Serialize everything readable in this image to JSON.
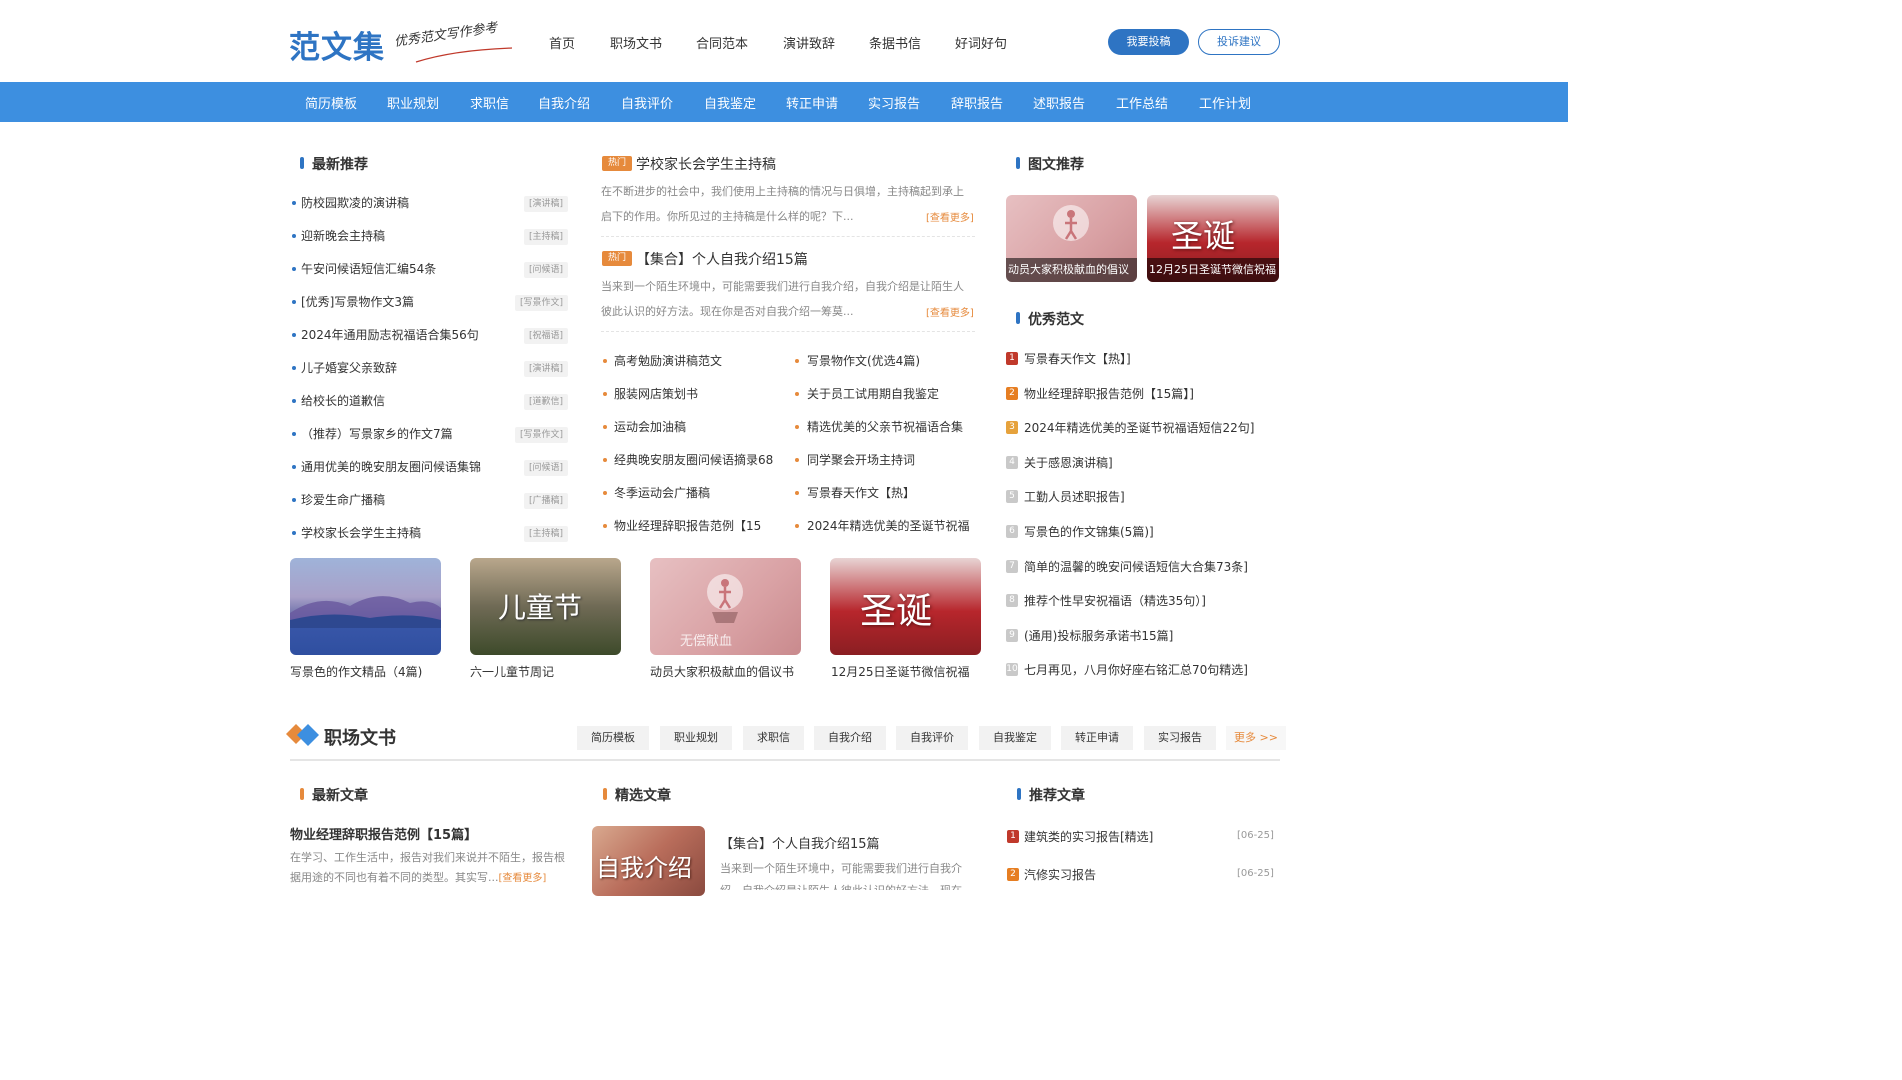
{
  "header": {
    "logo_main": "范文集",
    "logo_sub": "优秀范文写作参考",
    "nav": [
      "首页",
      "职场文书",
      "合同范本",
      "演讲致辞",
      "条据书信",
      "好词好句"
    ],
    "submit_button": "我要投稿",
    "feedback_button": "投诉建议"
  },
  "categories": [
    "简历模板",
    "职业规划",
    "求职信",
    "自我介绍",
    "自我评价",
    "自我鉴定",
    "转正申请",
    "实习报告",
    "辞职报告",
    "述职报告",
    "工作总结",
    "工作计划"
  ],
  "latest": {
    "title": "最新推荐",
    "items": [
      {
        "text": "防校园欺凌的演讲稿",
        "tag": "[演讲稿]"
      },
      {
        "text": "迎新晚会主持稿",
        "tag": "[主持稿]"
      },
      {
        "text": "午安问候语短信汇编54条",
        "tag": "[问候语]"
      },
      {
        "text": "[优秀]写景物作文3篇",
        "tag": "[写景作文]"
      },
      {
        "text": "2024年通用励志祝福语合集56句",
        "tag": "[祝福语]"
      },
      {
        "text": "儿子婚宴父亲致辞",
        "tag": "[演讲稿]"
      },
      {
        "text": "给校长的道歉信",
        "tag": "[道歉信]"
      },
      {
        "text": "（推荐）写景家乡的作文7篇",
        "tag": "[写景作文]"
      },
      {
        "text": "通用优美的晚安朋友圈问候语集锦",
        "tag": "[问候语]"
      },
      {
        "text": "珍爱生命广播稿",
        "tag": "[广播稿]"
      },
      {
        "text": "学校家长会学生主持稿",
        "tag": "[主持稿]"
      }
    ]
  },
  "featured": [
    {
      "badge": "热门",
      "title": "学校家长会学生主持稿",
      "desc": "在不断进步的社会中，我们使用上主持稿的情况与日俱增，主持稿起到承上启下的作用。你所见过的主持稿是什么样的呢？下...",
      "more": "[查看更多]"
    },
    {
      "badge": "热门",
      "title": "【集合】个人自我介绍15篇",
      "desc": "当来到一个陌生环境中，可能需要我们进行自我介绍，自我介绍是让陌生人彼此认识的好方法。现在你是否对自我介绍一筹莫...",
      "more": "[查看更多]"
    }
  ],
  "mid_list": {
    "left": [
      "高考勉励演讲稿范文",
      "服装网店策划书",
      "运动会加油稿",
      "经典晚安朋友圈问候语摘录68",
      "冬季运动会广播稿",
      "物业经理辞职报告范例【15"
    ],
    "right": [
      "写景物作文(优选4篇)",
      "关于员工试用期自我鉴定",
      "精选优美的父亲节祝福语合集",
      "同学聚会开场主持词",
      "写景春天作文【热】",
      "2024年精选优美的圣诞节祝福"
    ]
  },
  "thumbs": [
    {
      "label": "写景色的作文精品（4篇)"
    },
    {
      "label": "六一儿童节周记",
      "overlay": "儿童节"
    },
    {
      "label": "动员大家积极献血的倡议书",
      "overlay": "无偿献血"
    },
    {
      "label": "12月25日圣诞节微信祝福",
      "overlay": "圣诞"
    }
  ],
  "image_rec": {
    "title": "图文推荐",
    "items": [
      {
        "caption": "动员大家积极献血的倡议"
      },
      {
        "caption": "12月25日圣诞节微信祝福",
        "overlay": "圣诞"
      }
    ]
  },
  "excellent": {
    "title": "优秀范文",
    "items": [
      "写景春天作文【热】]",
      "物业经理辞职报告范例【15篇】]",
      "2024年精选优美的圣诞节祝福语短信22句]",
      "关于感恩演讲稿]",
      "工勤人员述职报告]",
      "写景色的作文锦集(5篇)]",
      "简单的温馨的晚安问候语短信大合集73条]",
      "推荐个性早安祝福语（精选35句）]",
      "(通用)投标服务承诺书15篇]",
      "七月再见，八月你好座右铭汇总70句精选]"
    ],
    "colors": [
      "#c0392b",
      "#e67e22",
      "#e6a23c",
      "#c9c9c9",
      "#c9c9c9",
      "#c9c9c9",
      "#c9c9c9",
      "#c9c9c9",
      "#c9c9c9",
      "#c9c9c9"
    ]
  },
  "section2": {
    "heading": "职场文书",
    "tabs": [
      "简历模板",
      "职业规划",
      "求职信",
      "自我介绍",
      "自我评价",
      "自我鉴定",
      "转正申请",
      "实习报告"
    ],
    "more": "更多 >>",
    "latest_title": "最新文章",
    "selected_title": "精选文章",
    "recommend_title": "推荐文章",
    "latest_article": {
      "title": "物业经理辞职报告范例【15篇】",
      "desc": "在学习、工作生活中，报告对我们来说并不陌生，报告根据用途的不同也有着不同的类型。其实写...",
      "more": "[查看更多]"
    },
    "selected_article": {
      "title": "【集合】个人自我介绍15篇",
      "desc": "当来到一个陌生环境中，可能需要我们进行自我介绍，自我介绍是让陌生人彼此认识的好方法。现在",
      "image_text": "自我介绍"
    },
    "recommend": [
      {
        "text": "建筑类的实习报告[精选]",
        "date": "[06-25]"
      },
      {
        "text": "汽修实习报告",
        "date": "[06-25]"
      }
    ]
  }
}
